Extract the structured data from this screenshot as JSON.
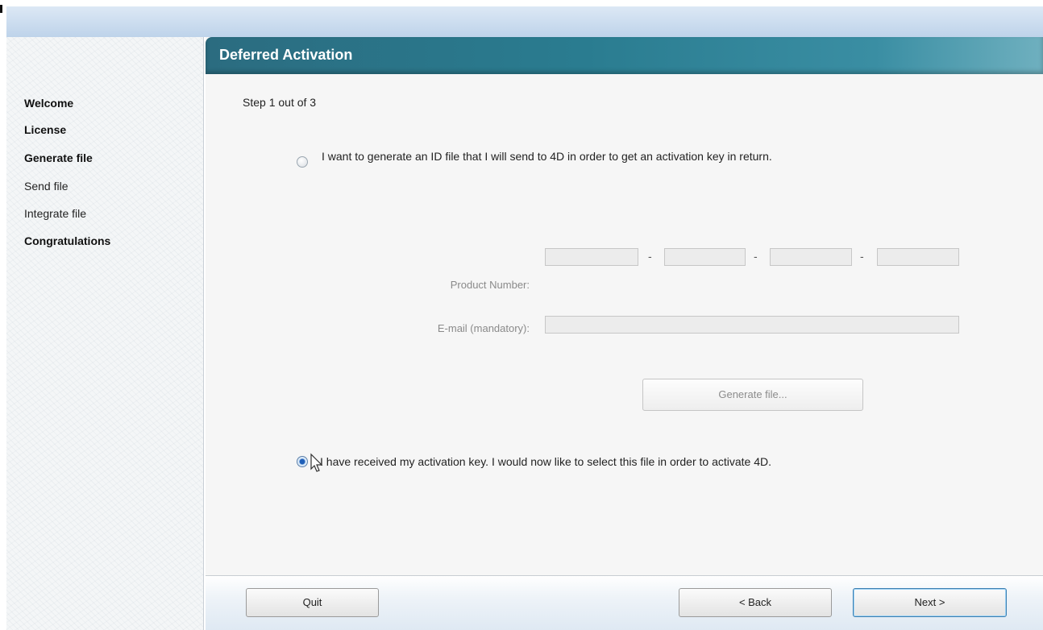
{
  "window": {
    "title": ""
  },
  "sidebar": {
    "items": [
      {
        "label": "Welcome",
        "bold": true
      },
      {
        "label": "License",
        "bold": true
      },
      {
        "label": "Generate file",
        "bold": true
      },
      {
        "label": "Send file",
        "bold": false
      },
      {
        "label": "Integrate file",
        "bold": false
      },
      {
        "label": "Congratulations",
        "bold": true
      }
    ]
  },
  "main": {
    "title": "Deferred Activation",
    "step": "Step 1 out of 3",
    "option_generate": {
      "label": "I want to generate an ID file that I will send to 4D in order to get an activation key in return.",
      "selected": false
    },
    "product_number": {
      "label": "Product Number:",
      "segments": [
        "",
        "",
        "",
        ""
      ],
      "separator": "-"
    },
    "email": {
      "label": "E-mail (mandatory):",
      "value": ""
    },
    "generate_button": {
      "label": "Generate file...",
      "enabled": false
    },
    "option_received": {
      "label": "I have received my activation key. I would now like to select this file in order to activate 4D.",
      "selected": true
    }
  },
  "footer": {
    "quit_label": "Quit",
    "back_label": "< Back",
    "next_label": "Next >"
  },
  "colors": {
    "header": "#2a7c90",
    "accent": "#3c7fb1"
  }
}
